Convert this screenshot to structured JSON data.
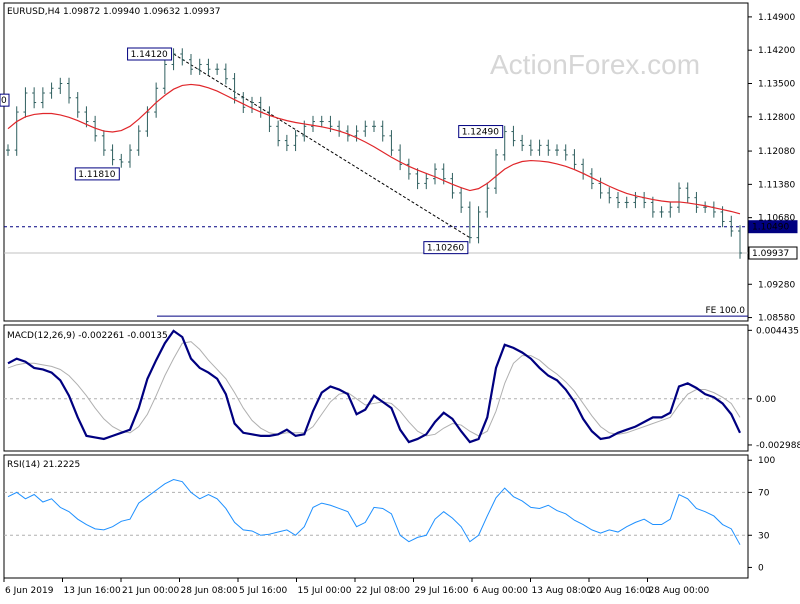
{
  "chart_data": [
    {
      "type": "line",
      "panel": "price",
      "title": "EURUSD,H4  1.09872 1.09940 1.09632 1.09937",
      "watermark": "ActionForex.com",
      "x_ticks": [
        "6 Jun 2019",
        "13 Jun 16:00",
        "21 Jun 00:00",
        "28 Jun 08:00",
        "5 Jul 16:00",
        "15 Jul 00:00",
        "22 Jul 08:00",
        "29 Jul 16:00",
        "6 Aug 00:00",
        "13 Aug 08:00",
        "20 Aug 16:00",
        "28 Aug 00:00"
      ],
      "y_ticks": [
        "1.14900",
        "1.14200",
        "1.13500",
        "1.12800",
        "1.12080",
        "1.11380",
        "1.10680",
        "1.09280",
        "1.08580"
      ],
      "ylim": [
        1.0855,
        1.1515
      ],
      "price_series": [
        1.121,
        1.129,
        1.133,
        1.131,
        1.133,
        1.134,
        1.135,
        1.132,
        1.129,
        1.127,
        1.124,
        1.121,
        1.119,
        1.1185,
        1.121,
        1.125,
        1.129,
        1.134,
        1.139,
        1.1412,
        1.14,
        1.138,
        1.139,
        1.138,
        1.138,
        1.136,
        1.132,
        1.13,
        1.131,
        1.129,
        1.126,
        1.123,
        1.122,
        1.124,
        1.126,
        1.127,
        1.127,
        1.126,
        1.125,
        1.124,
        1.125,
        1.126,
        1.126,
        1.124,
        1.121,
        1.118,
        1.116,
        1.114,
        1.115,
        1.117,
        1.115,
        1.112,
        1.109,
        1.1026,
        1.108,
        1.113,
        1.12,
        1.1249,
        1.123,
        1.122,
        1.121,
        1.122,
        1.121,
        1.121,
        1.12,
        1.118,
        1.116,
        1.114,
        1.112,
        1.111,
        1.11,
        1.11,
        1.111,
        1.11,
        1.108,
        1.108,
        1.109,
        1.113,
        1.111,
        1.109,
        1.109,
        1.108,
        1.106,
        1.104,
        1.09937
      ],
      "ma_series": [
        1.1255,
        1.127,
        1.128,
        1.1285,
        1.1287,
        1.1287,
        1.1284,
        1.1279,
        1.1272,
        1.1264,
        1.1256,
        1.125,
        1.1248,
        1.1251,
        1.126,
        1.1275,
        1.1292,
        1.131,
        1.1325,
        1.1338,
        1.1346,
        1.1348,
        1.1346,
        1.1341,
        1.1334,
        1.1325,
        1.1316,
        1.1307,
        1.1298,
        1.129,
        1.1283,
        1.1277,
        1.1272,
        1.1268,
        1.1265,
        1.1262,
        1.1259,
        1.1255,
        1.125,
        1.1244,
        1.1236,
        1.1227,
        1.1217,
        1.1206,
        1.1195,
        1.1185,
        1.1176,
        1.1168,
        1.1161,
        1.1154,
        1.1146,
        1.1138,
        1.1131,
        1.1125,
        1.1129,
        1.114,
        1.1155,
        1.117,
        1.118,
        1.1186,
        1.1188,
        1.1187,
        1.1185,
        1.1181,
        1.1176,
        1.1169,
        1.1161,
        1.1152,
        1.1143,
        1.1134,
        1.1126,
        1.1119,
        1.1114,
        1.111,
        1.1106,
        1.1103,
        1.1101,
        1.1101,
        1.1099,
        1.1096,
        1.1093,
        1.1089,
        1.1085,
        1.1081,
        1.1076
      ],
      "annotations": [
        {
          "label": "1.14120",
          "price": 1.1412,
          "index": 19
        },
        {
          "label": "1.11810",
          "price": 1.1181,
          "index": 13
        },
        {
          "label": "1.12490",
          "price": 1.1249,
          "index": 57
        },
        {
          "label": "1.10260",
          "price": 1.1026,
          "index": 53
        }
      ],
      "trendline": {
        "from": {
          "index": 19,
          "price": 1.1412
        },
        "to": {
          "index": 53,
          "price": 1.1026
        }
      },
      "horizontal_levels": [
        {
          "label": "1.10490",
          "price": 1.1049,
          "style": "dashed",
          "color": "#000080"
        },
        {
          "label": "1.09937",
          "price": 1.09937,
          "style": "solid",
          "color": "#c0c0c0"
        },
        {
          "label": "FE 100.0",
          "price": 1.0861,
          "style": "solid",
          "color": "#000080"
        }
      ],
      "edge_label": "0",
      "colors": {
        "bars": "#2f5f5f",
        "ma": "#e0262a",
        "level": "#000080",
        "axis": "#000000"
      }
    },
    {
      "type": "line",
      "panel": "macd",
      "title": "MACD(12,26,9) -0.002261 -0.00135",
      "y_ticks": [
        "0.004435",
        "0.00",
        "-0.002988"
      ],
      "ylim": [
        -0.00325,
        0.00465
      ],
      "zero_level": 0.0,
      "macd_series": [
        0.0023,
        0.0026,
        0.0024,
        0.002,
        0.0019,
        0.0017,
        0.0012,
        0.0002,
        -0.0012,
        -0.0024,
        -0.0025,
        -0.0026,
        -0.0024,
        -0.0022,
        -0.002,
        -0.0006,
        0.0013,
        0.0025,
        0.0036,
        0.0044,
        0.004,
        0.0026,
        0.002,
        0.0017,
        0.0013,
        0.0003,
        -0.0016,
        -0.0022,
        -0.0023,
        -0.0024,
        -0.0024,
        -0.0023,
        -0.002,
        -0.0024,
        -0.0023,
        -0.0008,
        0.0004,
        0.0008,
        0.0006,
        0.0003,
        -0.001,
        -0.0007,
        0.0002,
        -0.0002,
        -0.0006,
        -0.002,
        -0.0028,
        -0.0026,
        -0.0023,
        -0.0015,
        -0.0009,
        -0.0013,
        -0.0021,
        -0.0028,
        -0.0026,
        -0.0012,
        0.002,
        0.0035,
        0.0033,
        0.003,
        0.0026,
        0.002,
        0.0015,
        0.0012,
        0.0006,
        -0.0002,
        -0.0013,
        -0.0021,
        -0.0026,
        -0.0025,
        -0.0022,
        -0.002,
        -0.0018,
        -0.0015,
        -0.0012,
        -0.0012,
        -0.0009,
        0.0008,
        0.001,
        0.0007,
        0.0003,
        0.0001,
        -0.0003,
        -0.001,
        -0.0022
      ],
      "signal_series": [
        0.002,
        0.0022,
        0.0023,
        0.0023,
        0.0022,
        0.0021,
        0.0019,
        0.0015,
        0.0009,
        0.0002,
        -0.0006,
        -0.0013,
        -0.0018,
        -0.0021,
        -0.0022,
        -0.0018,
        -0.001,
        0.0002,
        0.0015,
        0.0026,
        0.0036,
        0.0037,
        0.0032,
        0.0025,
        0.0019,
        0.0013,
        0.0004,
        -0.0006,
        -0.0014,
        -0.0019,
        -0.0022,
        -0.0023,
        -0.0022,
        -0.0022,
        -0.0022,
        -0.0018,
        -0.001,
        -0.0002,
        0.0003,
        0.0004,
        0.0,
        -0.0004,
        -0.0003,
        -0.0002,
        -0.0003,
        -0.0008,
        -0.0015,
        -0.0021,
        -0.0024,
        -0.0023,
        -0.0019,
        -0.0016,
        -0.0017,
        -0.0021,
        -0.0024,
        -0.0021,
        -0.0008,
        0.001,
        0.0023,
        0.0028,
        0.0028,
        0.0025,
        0.002,
        0.0016,
        0.0011,
        0.0005,
        -0.0003,
        -0.0011,
        -0.0018,
        -0.0022,
        -0.0023,
        -0.0022,
        -0.002,
        -0.0018,
        -0.0016,
        -0.0014,
        -0.0012,
        -0.0004,
        0.0003,
        0.0006,
        0.0006,
        0.0004,
        0.0001,
        -0.0003,
        -0.0012
      ],
      "colors": {
        "macd": "#000080",
        "signal": "#b0b0b0"
      }
    },
    {
      "type": "line",
      "panel": "rsi",
      "title": "RSI(14) 21.2225",
      "y_ticks": [
        "100",
        "70",
        "30",
        "0"
      ],
      "ylim": [
        -8,
        103
      ],
      "levels": [
        70,
        30
      ],
      "rsi_series": [
        66,
        70,
        64,
        68,
        61,
        64,
        56,
        52,
        45,
        40,
        36,
        35,
        38,
        43,
        45,
        60,
        66,
        72,
        78,
        82,
        80,
        70,
        64,
        68,
        64,
        55,
        42,
        35,
        34,
        30,
        31,
        33,
        35,
        30,
        38,
        56,
        60,
        58,
        55,
        52,
        38,
        42,
        56,
        55,
        50,
        30,
        24,
        28,
        30,
        45,
        52,
        46,
        38,
        24,
        30,
        48,
        65,
        74,
        66,
        62,
        56,
        55,
        58,
        53,
        50,
        44,
        40,
        35,
        32,
        35,
        33,
        38,
        42,
        45,
        40,
        40,
        45,
        68,
        64,
        55,
        52,
        48,
        40,
        36,
        21.2
      ],
      "colors": {
        "rsi": "#1e90ff",
        "level": "#b0b0b0"
      }
    }
  ]
}
